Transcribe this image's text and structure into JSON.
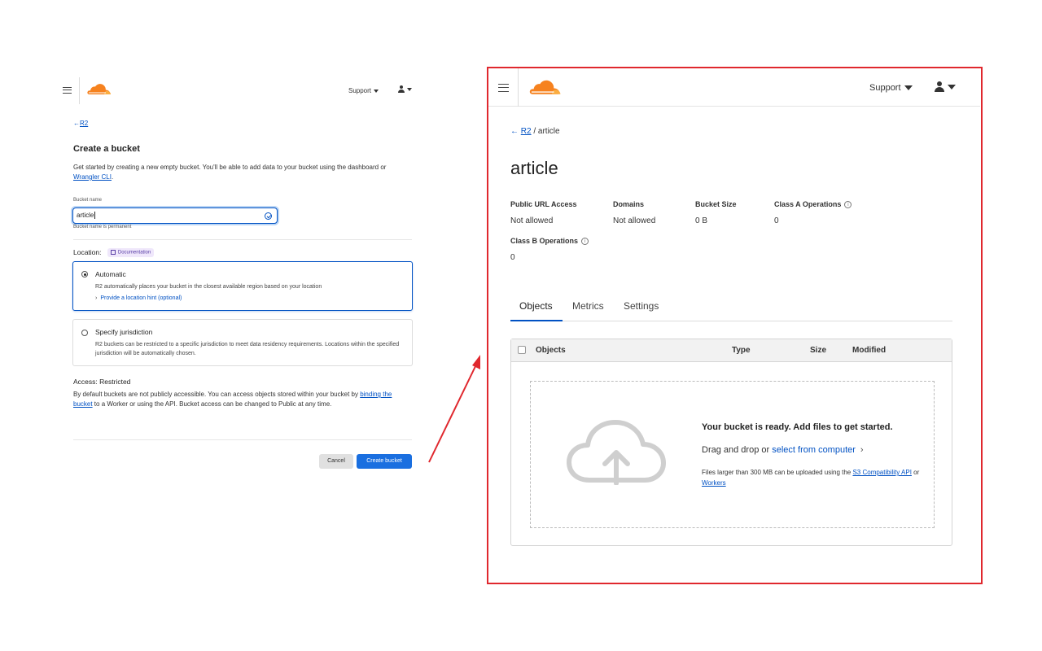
{
  "left": {
    "header": {
      "support_label": "Support"
    },
    "breadcrumb": {
      "back_label": "R2"
    },
    "title": "Create a bucket",
    "description": {
      "text_before": "Get started by creating a new empty bucket. You'll be able to add data to your bucket using the dashboard or ",
      "link": "Wrangler CLI",
      "text_after": "."
    },
    "bucket_name": {
      "label": "Bucket name",
      "value": "article",
      "hint": "Bucket name is permanent"
    },
    "location": {
      "label": "Location:",
      "doc_badge": "Documentation",
      "options": [
        {
          "title": "Automatic",
          "text": "R2 automatically places your bucket in the closest available region based on your location",
          "link": "Provide a location hint (optional)",
          "selected": true
        },
        {
          "title": "Specify jurisdiction",
          "text": "R2 buckets can be restricted to a specific jurisdiction to meet data residency requirements. Locations within the specified jurisdiction will be automatically chosen.",
          "selected": false
        }
      ]
    },
    "access": {
      "label": "Access:",
      "value": "Restricted",
      "text_before": "By default buckets are not publicly accessible. You can access objects stored within your bucket by ",
      "link": "binding the bucket",
      "text_after": " to a Worker or using the API. Bucket access can be changed to Public at any time."
    },
    "buttons": {
      "cancel": "Cancel",
      "create": "Create bucket"
    }
  },
  "right": {
    "header": {
      "support_label": "Support"
    },
    "breadcrumb": {
      "back_label": "R2",
      "current": "/ article"
    },
    "title": "article",
    "stats": [
      {
        "label": "Public URL Access",
        "value": "Not allowed"
      },
      {
        "label": "Domains",
        "value": "Not allowed"
      },
      {
        "label": "Bucket Size",
        "value": "0 B"
      },
      {
        "label": "Class A Operations",
        "value": "0"
      },
      {
        "label": "Class B Operations",
        "value": "0"
      }
    ],
    "tabs": [
      "Objects",
      "Metrics",
      "Settings"
    ],
    "table": {
      "columns": [
        "Objects",
        "Type",
        "Size",
        "Modified"
      ],
      "empty_title": "Your bucket is ready. Add files to get started.",
      "drag_text": "Drag and drop or ",
      "select_link": "select from computer",
      "note_before": "Files larger than 300 MB can be uploaded using the ",
      "note_link1": "S3 Compatibility API",
      "note_mid": " or ",
      "note_link2": "Workers"
    }
  },
  "colors": {
    "accent": "#0051c3",
    "cloudflare_orange": "#f6821f",
    "highlight_border": "#e0282e",
    "arrow": "#e0282e"
  }
}
